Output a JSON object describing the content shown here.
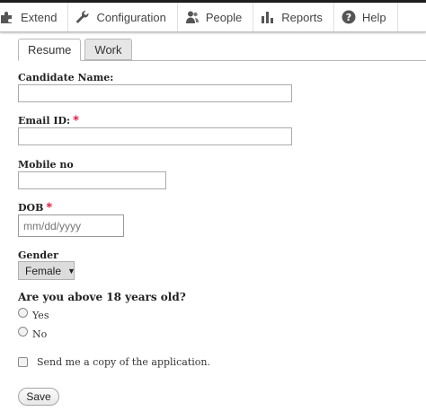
{
  "toolbar": {
    "items": [
      {
        "label": "Extend",
        "icon": "puzzle-icon"
      },
      {
        "label": "Configuration",
        "icon": "wrench-icon"
      },
      {
        "label": "People",
        "icon": "people-icon"
      },
      {
        "label": "Reports",
        "icon": "bar-chart-icon"
      },
      {
        "label": "Help",
        "icon": "help-icon"
      }
    ]
  },
  "tabs": [
    {
      "label": "Resume",
      "active": true
    },
    {
      "label": "Work",
      "active": false
    }
  ],
  "form": {
    "candidate_name": {
      "label": "Candidate Name:",
      "value": ""
    },
    "email": {
      "label": "Email ID:",
      "required_mark": "*",
      "value": ""
    },
    "mobile": {
      "label": "Mobile no",
      "value": ""
    },
    "dob": {
      "label": "DOB",
      "required_mark": "*",
      "placeholder": "mm/dd/yyyy"
    },
    "gender": {
      "label": "Gender",
      "selected": "Female",
      "arrow": "▼"
    },
    "age_question": "Are you above 18 years old?",
    "options": [
      "Yes",
      "No"
    ],
    "copy_label": "Send me a copy of the application.",
    "save_label": "Save"
  },
  "colors": {
    "required": "#e0002a",
    "toolbar_bg": "#ffffff",
    "top_strip": "#1f1f1f"
  }
}
